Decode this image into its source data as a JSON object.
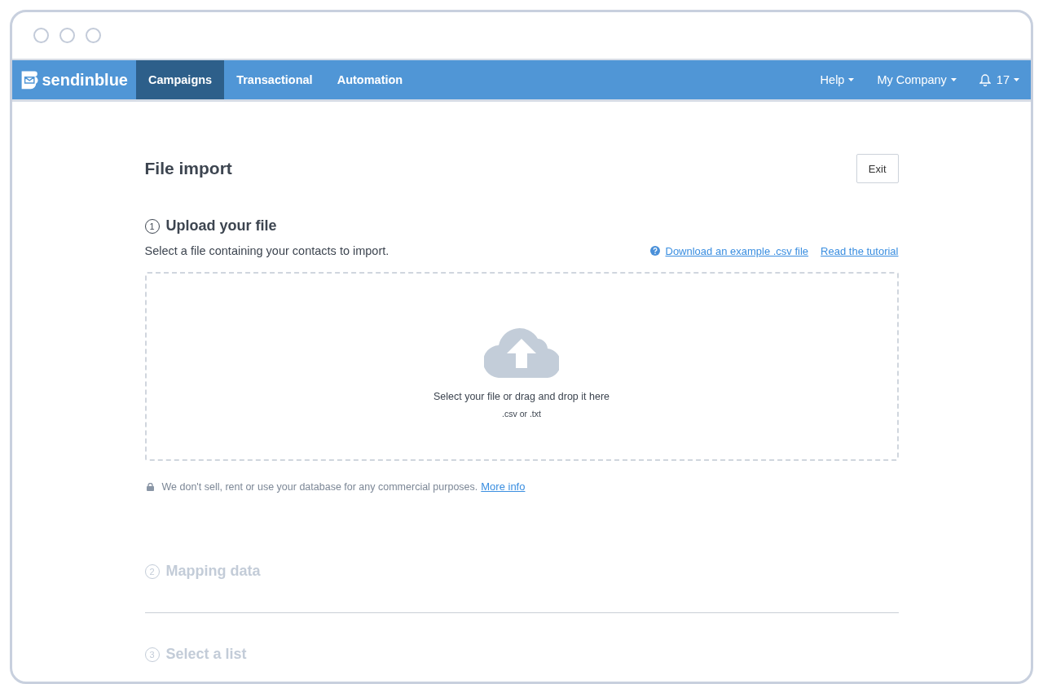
{
  "brand": {
    "name": "sendinblue"
  },
  "nav": {
    "items": [
      {
        "label": "Campaigns",
        "selected": true
      },
      {
        "label": "Transactional",
        "selected": false
      },
      {
        "label": "Automation",
        "selected": false
      }
    ],
    "right": [
      {
        "kind": "menu",
        "label": "Help"
      },
      {
        "kind": "menu",
        "label": "My Company"
      },
      {
        "kind": "bell",
        "label": "17"
      }
    ]
  },
  "page": {
    "title": "File import",
    "exit_button": "Exit"
  },
  "steps": [
    {
      "number": "1",
      "title": "Upload your file",
      "active": true
    },
    {
      "number": "2",
      "title": "Mapping data",
      "active": false
    },
    {
      "number": "3",
      "title": "Select a list",
      "active": false
    }
  ],
  "upload": {
    "instruction": "Select a file containing your contacts to import.",
    "links": [
      "Download an example .csv file",
      "Read the tutorial"
    ],
    "drop_text": "Select your file or drag and drop it here",
    "formats": ".csv or .txt",
    "privacy_note": "We don't sell, rent or use your database for any commercial purposes.",
    "privacy_link": "More info"
  }
}
